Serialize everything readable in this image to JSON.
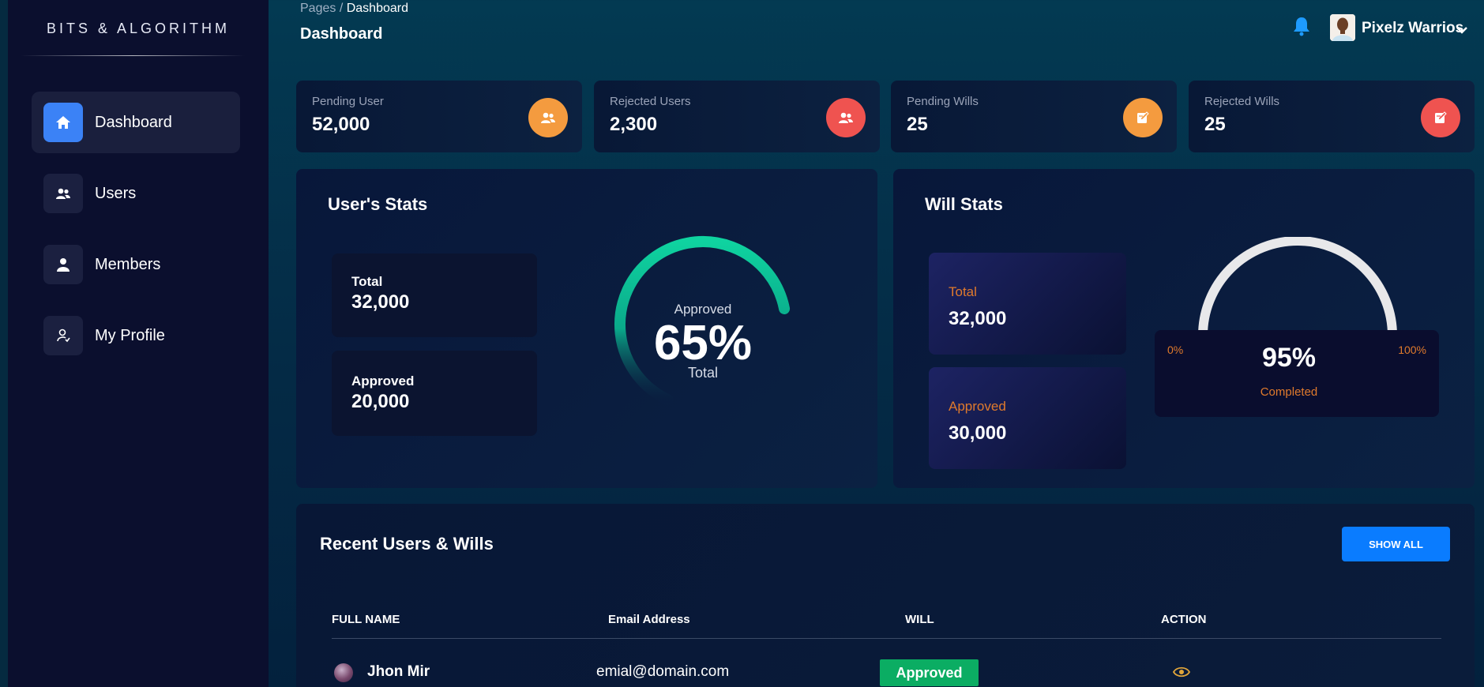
{
  "brand": "BITS & ALGORITHM",
  "sidebar": {
    "items": [
      {
        "label": "Dashboard",
        "icon": "home-icon",
        "active": true
      },
      {
        "label": "Users",
        "icon": "users-icon"
      },
      {
        "label": "Members",
        "icon": "person-icon"
      },
      {
        "label": "My Profile",
        "icon": "profile-icon"
      }
    ]
  },
  "header": {
    "breadcrumb_parent": "Pages",
    "breadcrumb_separator": " / ",
    "breadcrumb_current": "Dashboard",
    "title": "Dashboard",
    "user_name": "Pixelz Warrios"
  },
  "stats": [
    {
      "label": "Pending User",
      "value": "52,000",
      "icon": "users-icon",
      "color": "#f49b3f"
    },
    {
      "label": "Rejected Users",
      "value": "2,300",
      "icon": "users-icon",
      "color": "#ef5350"
    },
    {
      "label": "Pending Wills",
      "value": "25",
      "icon": "edit-icon",
      "color": "#f49b3f"
    },
    {
      "label": "Rejected Wills",
      "value": "25",
      "icon": "edit-icon",
      "color": "#ef5350"
    }
  ],
  "users_stats": {
    "title": "User's Stats",
    "total_label": "Total",
    "total_value": "32,000",
    "approved_label": "Approved",
    "approved_value": "20,000",
    "gauge": {
      "top_label": "Approved",
      "percent": "65%",
      "bottom_label": "Total",
      "fraction": 0.65
    }
  },
  "will_stats": {
    "title": "Will Stats",
    "total_label": "Total",
    "total_value": "32,000",
    "approved_label": "Approved",
    "approved_value": "30,000",
    "gauge": {
      "min_label": "0%",
      "max_label": "100%",
      "percent": "95%",
      "caption": "Completed",
      "fraction": 0.95
    }
  },
  "recent": {
    "title": "Recent Users & Wills",
    "show_all": "SHOW ALL",
    "columns": [
      "FULL NAME",
      "Email Address",
      "WILL",
      "ACTION"
    ],
    "rows": [
      {
        "name": "Jhon Mir",
        "email": "emial@domain.com",
        "will": "Approved",
        "action_icon": "eye-icon"
      }
    ]
  },
  "colors": {
    "accent_blue": "#3b82f6",
    "orange": "#f49b3f",
    "red": "#ef5350",
    "green_badge": "#0bad63",
    "gauge_teal": "#0fd3a0",
    "will_label_orange": "#e07a2c"
  }
}
